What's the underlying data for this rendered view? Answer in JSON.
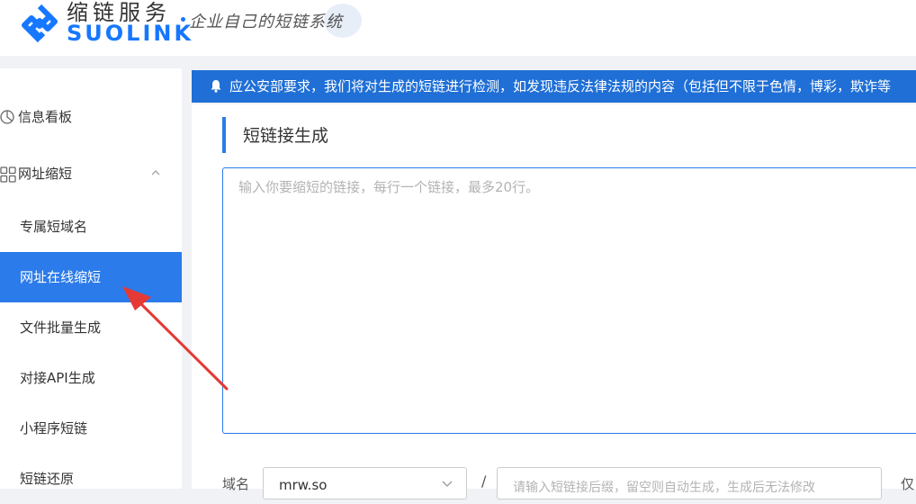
{
  "header": {
    "brand_cn": "缩链服务",
    "brand_en": "SUOLINK",
    "slogan": "企业自己的短链系统"
  },
  "sidebar": {
    "items": [
      {
        "label": "信息看板",
        "icon": "clock-icon"
      },
      {
        "label": "网址缩短",
        "icon": "grid-icon",
        "expanded": true
      },
      {
        "label": "专属短域名"
      },
      {
        "label": "网址在线缩短",
        "active": true
      },
      {
        "label": "文件批量生成"
      },
      {
        "label": "对接API生成"
      },
      {
        "label": "小程序短链"
      },
      {
        "label": "短链还原"
      }
    ]
  },
  "notice": {
    "text": "应公安部要求，我们将对生成的短链进行检测，如发现违反法律法规的内容（包括但不限于色情，博彩，欺诈等"
  },
  "main": {
    "section_title": "短链接生成",
    "textarea_placeholder": "输入你要缩短的链接，每行一个链接，最多20行。",
    "domain_label": "域名",
    "domain_value": "mrw.so",
    "slash": "/",
    "suffix_placeholder": "请输入短链接后缀，留空则自动生成，生成后无法修改",
    "trailing_text": "仅"
  },
  "colors": {
    "accent": "#2b7bea",
    "notice_bg": "#1f6fd6",
    "annotation_arrow": "#e53935"
  }
}
